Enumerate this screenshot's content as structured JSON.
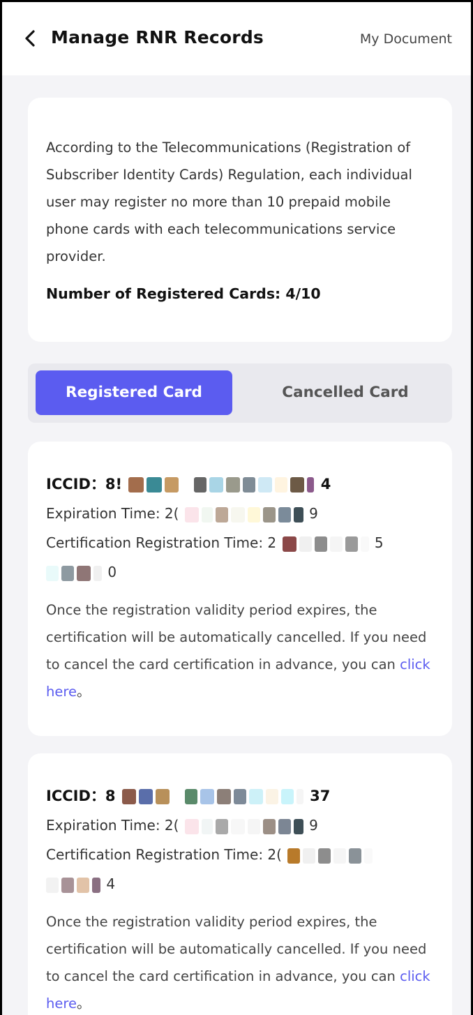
{
  "header": {
    "title": "Manage RNR Records",
    "my_document_label": "My Document"
  },
  "info": {
    "description": "According to the Telecommunications (Registration of Subscriber Identity Cards) Regulation, each individual user may register no more than 10 prepaid mobile phone cards with each telecommunications service provider.",
    "registered_count_label": "Number of Registered Cards: 4/10"
  },
  "tabs": [
    {
      "label": "Registered Card",
      "active": true
    },
    {
      "label": "Cancelled Card",
      "active": false
    }
  ],
  "cards": [
    {
      "iccid_label": "ICCID：",
      "iccid_start": "8!",
      "iccid_end": "4",
      "expiration_label": "Expiration Time: ",
      "expiration_start": "2(",
      "expiration_end": "9",
      "registration_label": "Certification Registration Time: ",
      "registration_start": "2",
      "registration_end": "5",
      "registration_line2_end": "0",
      "note_text": "Once the registration validity period expires, the certification will be automatically cancelled. If you need to cancel the card certification in advance, you can ",
      "link_text": "click here",
      "note_suffix": "。"
    },
    {
      "iccid_label": "ICCID：",
      "iccid_start": "8",
      "iccid_end": "37",
      "expiration_label": "Expiration Time: ",
      "expiration_start": "2(",
      "expiration_end": "9",
      "registration_label": "Certification Registration Time: ",
      "registration_start": "2(",
      "registration_end": "",
      "registration_line2_end": "4",
      "note_text": "Once the registration validity period expires, the certification will be automatically cancelled. If you need to cancel the card certification in advance, you can ",
      "link_text": "click here",
      "note_suffix": "。"
    }
  ],
  "colors": {
    "accent": "#5b5cf0",
    "background": "#f4f4f7",
    "card": "#ffffff"
  },
  "icons": {
    "back": "chevron-left-icon"
  }
}
